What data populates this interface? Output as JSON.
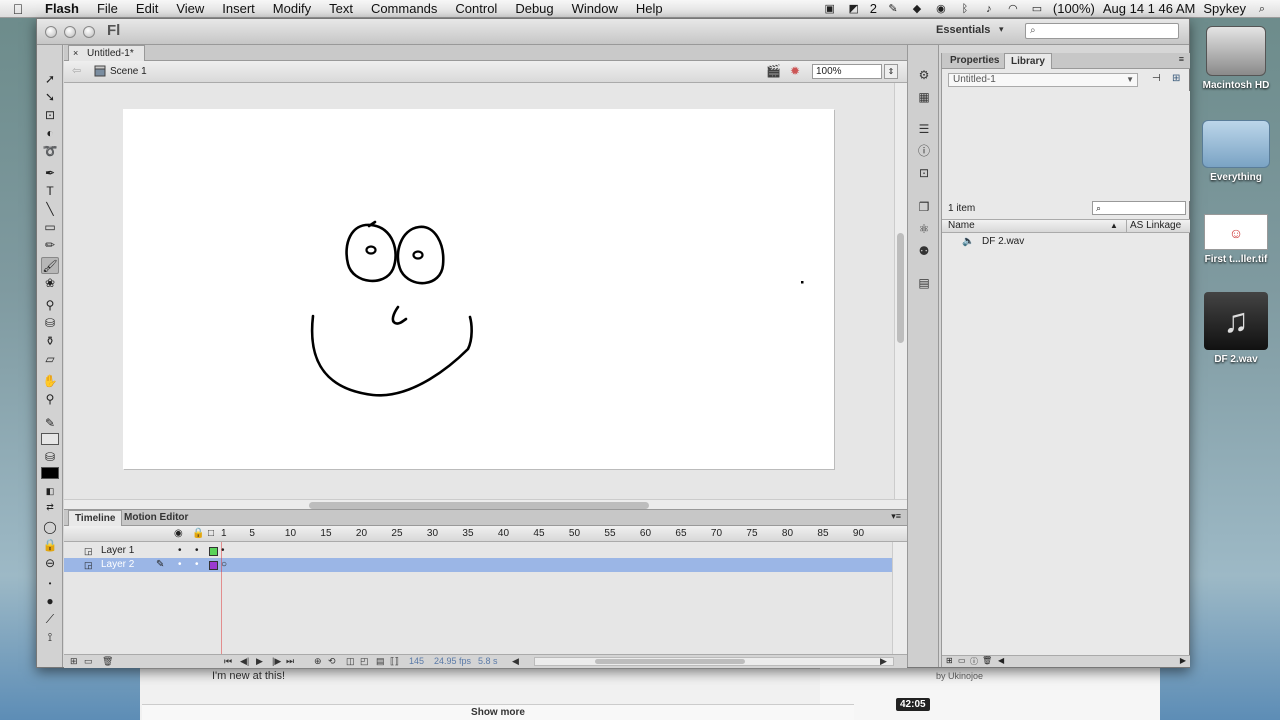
{
  "menubar": {
    "apple": "",
    "items": [
      "Flash",
      "File",
      "Edit",
      "View",
      "Insert",
      "Modify",
      "Text",
      "Commands",
      "Control",
      "Debug",
      "Window",
      "Help"
    ],
    "status": {
      "display_badge": "2",
      "battery": "(100%)",
      "datetime": "Aug 14  1 46 AM",
      "user": "Spykey"
    }
  },
  "desktop": {
    "icons": [
      {
        "label": "Macintosh HD",
        "icon": "hard-drive-icon"
      },
      {
        "label": "Everything",
        "icon": "folder-icon"
      },
      {
        "label": "First t...ller.tif",
        "icon": "image-file-icon"
      },
      {
        "label": "DF 2.wav",
        "icon": "audio-file-icon",
        "glyph": "♫"
      }
    ]
  },
  "background_page": {
    "comment": "I'm new at this!",
    "show_more": "Show more",
    "by": "by Ukinojoe",
    "duration": "42:05"
  },
  "window": {
    "app_logo": "Fl",
    "workspace": "Essentials",
    "workspace_caret": "▾"
  },
  "document": {
    "tab_close": "×",
    "tab_title": "Untitled-1*",
    "scene": "Scene 1",
    "zoom": "100%"
  },
  "library": {
    "tabs": [
      "Properties",
      "Library"
    ],
    "active_tab": "Library",
    "document": "Untitled-1",
    "count": "1 item",
    "columns": {
      "name": "Name",
      "linkage": "AS Linkage",
      "sort": "▲"
    },
    "items": [
      {
        "name": "DF 2.wav",
        "icon": "sound-icon"
      }
    ]
  },
  "timeline": {
    "tabs": [
      "Timeline",
      "Motion Editor"
    ],
    "frame_labels": [
      "1",
      "5",
      "10",
      "15",
      "20",
      "25",
      "30",
      "35",
      "40",
      "45",
      "50",
      "55",
      "60",
      "65",
      "70",
      "75",
      "80",
      "85",
      "90"
    ],
    "layers": [
      {
        "name": "Layer 1",
        "color": "#5ad35a",
        "selected": false
      },
      {
        "name": "Layer 2",
        "color": "#9a3ad0",
        "selected": true
      }
    ],
    "status": {
      "frame": "145",
      "fps": "24.95 fps",
      "time": "5.8 s"
    }
  },
  "colors": {
    "stroke_color": "#000000",
    "fill_color": "#000000",
    "selection": "#9bb6e6",
    "stage_bg": "#ffffff"
  }
}
